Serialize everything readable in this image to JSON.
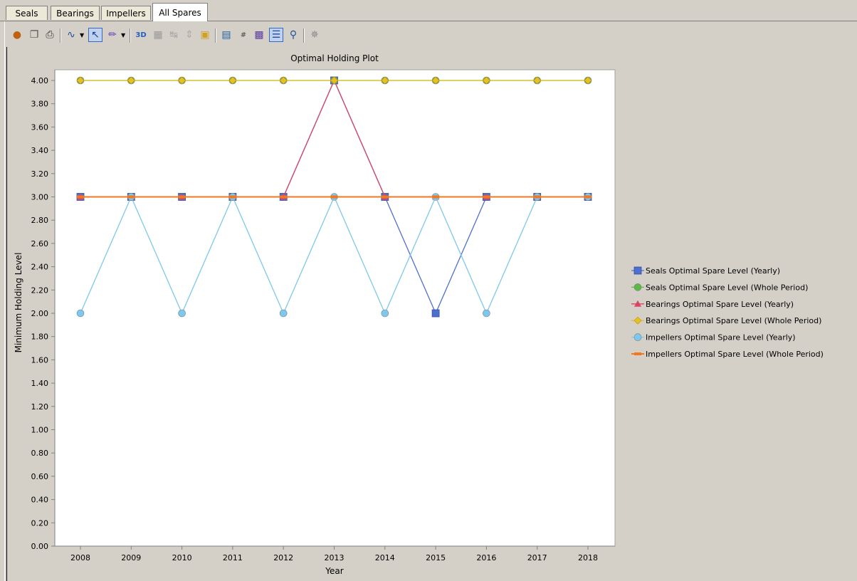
{
  "tabs": [
    {
      "label": "Seals"
    },
    {
      "label": "Bearings"
    },
    {
      "label": "Impellers"
    },
    {
      "label": "All Spares"
    }
  ],
  "toolbar": {
    "icons": [
      "members-icon",
      "copy-icon",
      "print-icon",
      "line-chart-icon",
      "select-pointer-icon",
      "color-palette-icon",
      "3d-icon",
      "grid-icon",
      "rotate-icon",
      "flip-icon",
      "export-icon",
      "chart-wizard-icon",
      "data-labels-icon",
      "data-table-icon",
      "legend-icon",
      "zoom-icon",
      "magic-wand-icon"
    ]
  },
  "chart_data": {
    "type": "line",
    "title": "Optimal Holding Plot",
    "xlabel": "Year",
    "ylabel": "Minimum Holding Level",
    "categories": [
      "2008",
      "2009",
      "2010",
      "2011",
      "2012",
      "2013",
      "2014",
      "2015",
      "2016",
      "2017",
      "2018"
    ],
    "ylim": [
      0,
      4
    ],
    "yticks": [
      "0.00",
      "0.20",
      "0.40",
      "0.60",
      "0.80",
      "1.00",
      "1.20",
      "1.40",
      "1.60",
      "1.80",
      "2.00",
      "2.20",
      "2.40",
      "2.60",
      "2.80",
      "3.00",
      "3.20",
      "3.40",
      "3.60",
      "3.80",
      "4.00"
    ],
    "grid": false,
    "legend_position": "right",
    "series": [
      {
        "name": "Seals Optimal Spare Level (Yearly)",
        "color": "#4f6fd0",
        "marker": "square",
        "values": [
          3,
          3,
          3,
          3,
          3,
          4,
          3,
          2,
          3,
          3,
          3
        ]
      },
      {
        "name": "Seals Optimal Spare Level (Whole Period)",
        "color": "#5bb948",
        "marker": "circle",
        "values": [
          4,
          4,
          4,
          4,
          4,
          4,
          4,
          4,
          4,
          4,
          4
        ]
      },
      {
        "name": "Bearings Optimal Spare Level (Yearly)",
        "color": "#d84664",
        "marker": "triangle",
        "values": [
          3,
          3,
          3,
          3,
          3,
          4,
          3,
          3,
          3,
          3,
          3
        ]
      },
      {
        "name": "Bearings Optimal Spare Level (Whole Period)",
        "color": "#e8c020",
        "marker": "diamond",
        "values": [
          4,
          4,
          4,
          4,
          4,
          4,
          4,
          4,
          4,
          4,
          4
        ]
      },
      {
        "name": "Impellers Optimal Spare Level (Yearly)",
        "color": "#7cc8ee",
        "marker": "circle",
        "values": [
          2,
          3,
          2,
          3,
          2,
          3,
          2,
          3,
          2,
          3,
          3
        ]
      },
      {
        "name": "Impellers Optimal Spare Level (Whole Period)",
        "color": "#f07820",
        "marker": "dash",
        "values": [
          3,
          3,
          3,
          3,
          3,
          3,
          3,
          3,
          3,
          3,
          3
        ]
      }
    ]
  }
}
